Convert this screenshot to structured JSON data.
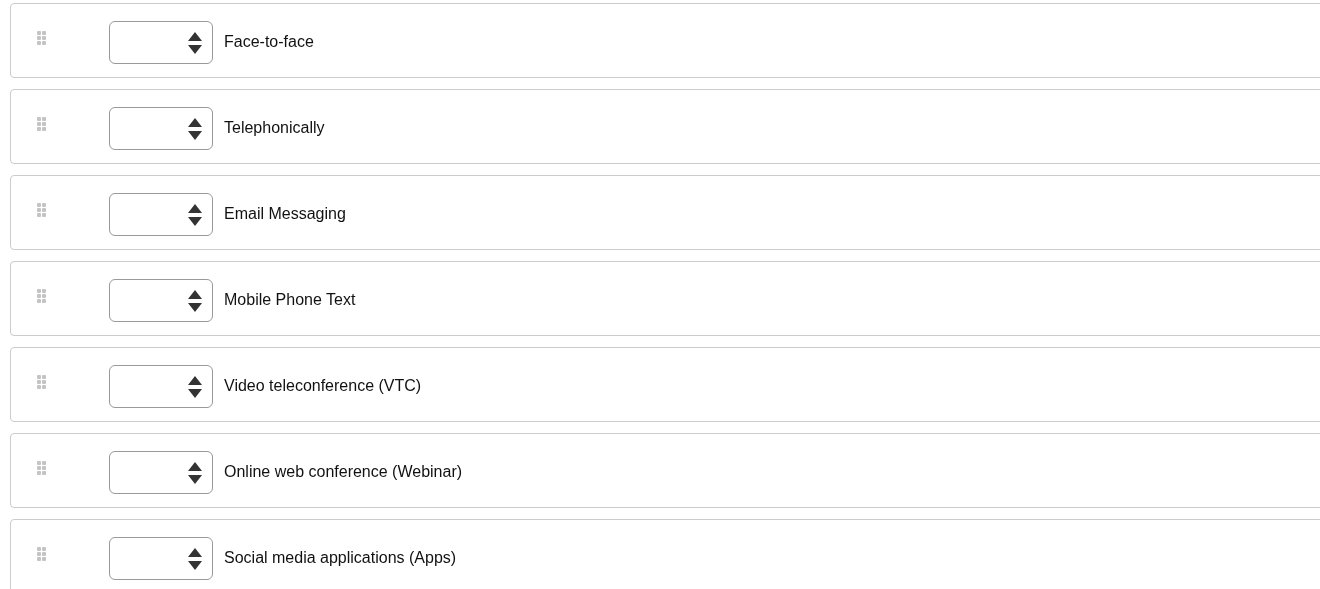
{
  "items": [
    {
      "label": "Face-to-face"
    },
    {
      "label": "Telephonically"
    },
    {
      "label": "Email Messaging"
    },
    {
      "label": "Mobile Phone Text"
    },
    {
      "label": "Video teleconference (VTC)"
    },
    {
      "label": "Online web conference (Webinar)"
    },
    {
      "label": "Social media applications (Apps)"
    }
  ]
}
